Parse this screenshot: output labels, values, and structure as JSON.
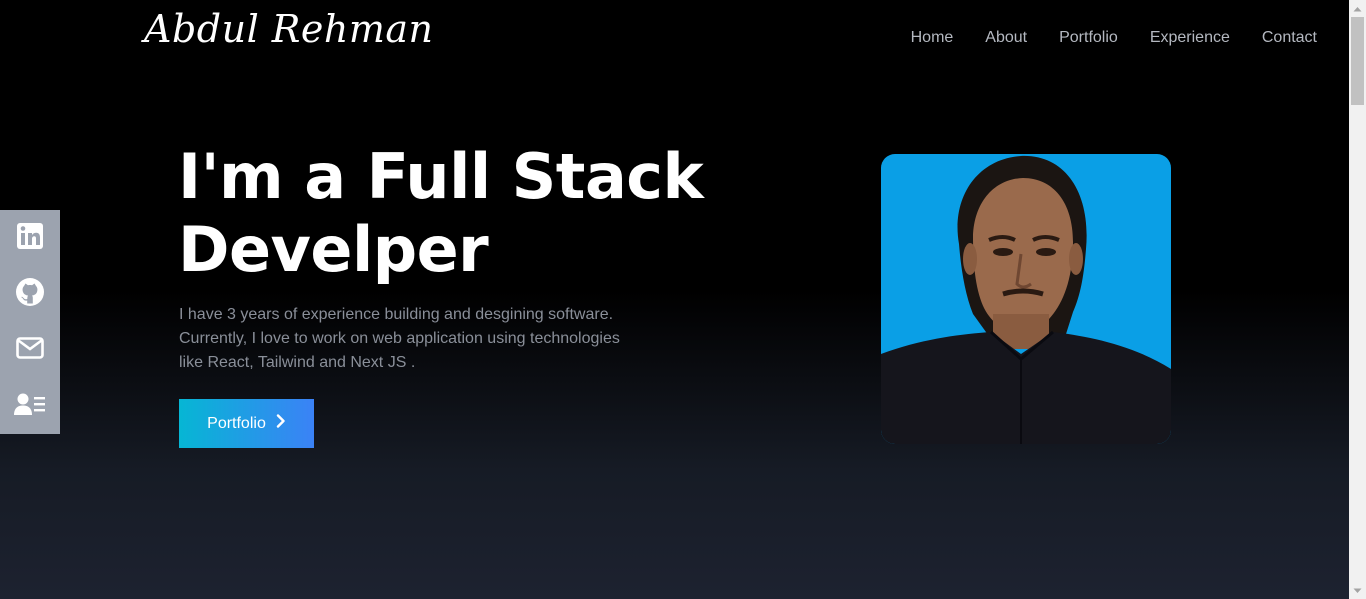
{
  "brand": {
    "name": "Abdul Rehman"
  },
  "nav": {
    "items": [
      {
        "label": "Home"
      },
      {
        "label": "About"
      },
      {
        "label": "Portfolio"
      },
      {
        "label": "Experience"
      },
      {
        "label": "Contact"
      }
    ]
  },
  "hero": {
    "title_line1": "I'm a Full Stack",
    "title_line2": "Develper",
    "description": "I have 3 years of experience building and desgining software. Currently, I love to work on web application using technologies like React, Tailwind and Next JS .",
    "button_label": "Portfolio"
  },
  "social": {
    "icons": [
      "linkedin-icon",
      "github-icon",
      "mail-icon",
      "resume-icon"
    ]
  },
  "colors": {
    "accent_from": "#06b6d4",
    "accent_to": "#3b82f6",
    "photo_bg": "#0a9fe6",
    "social_bg": "#9ca3af"
  }
}
